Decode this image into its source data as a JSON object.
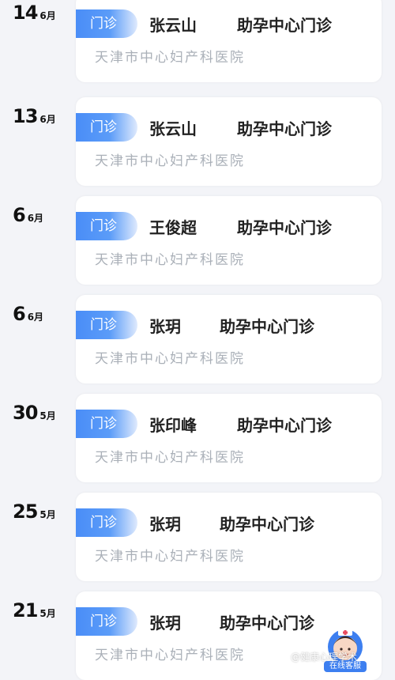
{
  "records": [
    {
      "day": "14",
      "month": "6月",
      "tag": "门诊",
      "doctor": "张云山",
      "department": "助孕中心门诊",
      "hospital": "天津市中心妇产科医院"
    },
    {
      "day": "13",
      "month": "6月",
      "tag": "门诊",
      "doctor": "张云山",
      "department": "助孕中心门诊",
      "hospital": "天津市中心妇产科医院"
    },
    {
      "day": "6",
      "month": "6月",
      "tag": "门诊",
      "doctor": "王俊超",
      "department": "助孕中心门诊",
      "hospital": "天津市中心妇产科医院"
    },
    {
      "day": "6",
      "month": "6月",
      "tag": "门诊",
      "doctor": "张玥",
      "department": "助孕中心门诊",
      "hospital": "天津市中心妇产科医院"
    },
    {
      "day": "30",
      "month": "5月",
      "tag": "门诊",
      "doctor": "张印峰",
      "department": "助孕中心门诊",
      "hospital": "天津市中心妇产科医院"
    },
    {
      "day": "25",
      "month": "5月",
      "tag": "门诊",
      "doctor": "张玥",
      "department": "助孕中心门诊",
      "hospital": "天津市中心妇产科医院"
    },
    {
      "day": "21",
      "month": "5月",
      "tag": "门诊",
      "doctor": "张玥",
      "department": "助孕中心门诊",
      "hospital": "天津市中心妇产科医院"
    }
  ],
  "customer_service": {
    "label": "在线客服",
    "icon": "nurse-avatar-icon"
  },
  "watermark": "@健康心理学术",
  "colors": {
    "tag_blue": "#4a8df7",
    "hospital_gray": "#aab0b8",
    "background": "#f3f4f8"
  }
}
